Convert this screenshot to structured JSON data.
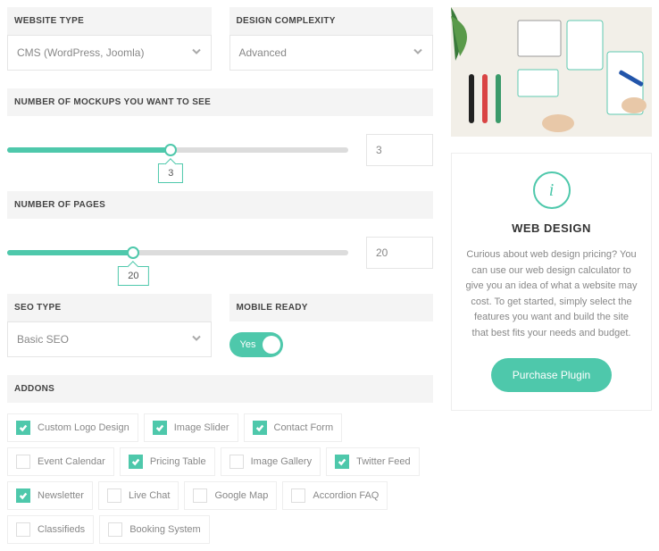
{
  "fields": {
    "website_type": {
      "label": "WEBSITE TYPE",
      "value": "CMS (WordPress, Joomla)"
    },
    "design_complexity": {
      "label": "DESIGN COMPLEXITY",
      "value": "Advanced"
    },
    "mockups": {
      "label": "NUMBER OF MOCKUPS YOU WANT TO SEE",
      "value": "3",
      "percent": 48
    },
    "pages": {
      "label": "NUMBER OF PAGES",
      "value": "20",
      "percent": 37
    },
    "seo_type": {
      "label": "SEO TYPE",
      "value": "Basic SEO"
    },
    "mobile_ready": {
      "label": "MOBILE READY",
      "toggle": "Yes"
    },
    "addons_label": "ADDONS"
  },
  "addons": [
    {
      "label": "Custom Logo Design",
      "checked": true
    },
    {
      "label": "Image Slider",
      "checked": true
    },
    {
      "label": "Contact Form",
      "checked": true
    },
    {
      "label": "Event Calendar",
      "checked": false
    },
    {
      "label": "Pricing Table",
      "checked": true
    },
    {
      "label": "Image Gallery",
      "checked": false
    },
    {
      "label": "Twitter Feed",
      "checked": true
    },
    {
      "label": "Newsletter",
      "checked": true
    },
    {
      "label": "Live Chat",
      "checked": false
    },
    {
      "label": "Google Map",
      "checked": false
    },
    {
      "label": "Accordion FAQ",
      "checked": false
    },
    {
      "label": "Classifieds",
      "checked": false
    },
    {
      "label": "Booking System",
      "checked": false
    }
  ],
  "sidebar": {
    "title": "WEB DESIGN",
    "body": "Curious about web design pricing? You can use our web design calculator to give you an idea of what a website may cost. To get started, simply select the features you want and build the site that best fits your needs and budget.",
    "button": "Purchase Plugin"
  }
}
